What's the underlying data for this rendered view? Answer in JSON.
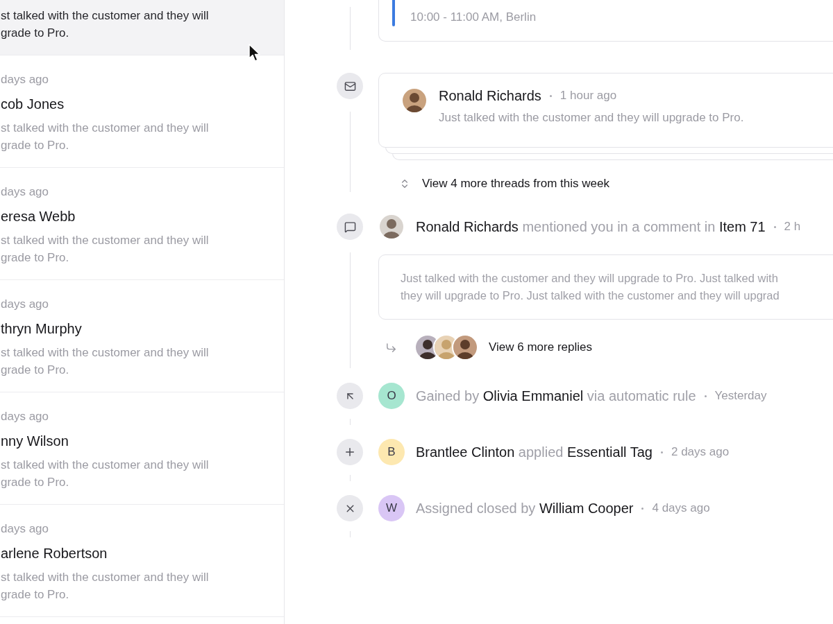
{
  "list_items": [
    {
      "selected": true,
      "body_lines": [
        "st talked with the customer and they will",
        "grade to Pro."
      ]
    },
    {
      "selected": false,
      "time": "days ago",
      "name": "cob Jones",
      "body_lines": [
        "st talked with the customer and they will",
        "grade to Pro."
      ]
    },
    {
      "selected": false,
      "time": "days ago",
      "name": "eresa Webb",
      "body_lines": [
        "st talked with the customer and they will",
        "grade to Pro."
      ]
    },
    {
      "selected": false,
      "time": "days ago",
      "name": "thryn Murphy",
      "body_lines": [
        "st talked with the customer and they will",
        "grade to Pro."
      ]
    },
    {
      "selected": false,
      "time": "days ago",
      "name": "nny Wilson",
      "body_lines": [
        "st talked with the customer and they will",
        "grade to Pro."
      ]
    },
    {
      "selected": false,
      "time": "days ago",
      "name": "arlene Robertson",
      "body_lines": [
        "st talked with the customer and they will",
        "grade to Pro."
      ]
    }
  ],
  "timeline": [
    {
      "kind": "event",
      "subtitle": "10:00 - 11:00 AM, Berlin"
    },
    {
      "kind": "thread",
      "author": "Ronald Richards",
      "time": "1 hour ago",
      "message": "Just talked with the customer and they will upgrade to Pro.",
      "more": "View 4 more threads from this week"
    },
    {
      "kind": "mention",
      "headline": "**Ronald Richards** mentioned you in a comment in **Item 71**",
      "time": "2 h",
      "comment_lines": [
        "Just talked with the customer and they will upgrade to Pro. Just talked with",
        "they will upgrade to Pro. Just talked with the customer and they will upgrad"
      ],
      "replies": "View 6 more replies"
    },
    {
      "kind": "gained",
      "letter": "O",
      "color": "#a6e6d0",
      "text": "Gained by **Olivia Emmaniel** via automatic rule",
      "time": "Yesterday"
    },
    {
      "kind": "tagged",
      "letter": "B",
      "color": "#fde8b0",
      "text": "**Brantlee Clinton** applied **Essentiall Tag**",
      "time": "2 days ago"
    },
    {
      "kind": "closed",
      "letter": "W",
      "color": "#d9c6f5",
      "text": "Assigned closed by **William Cooper**",
      "time": "4 days ago"
    }
  ]
}
